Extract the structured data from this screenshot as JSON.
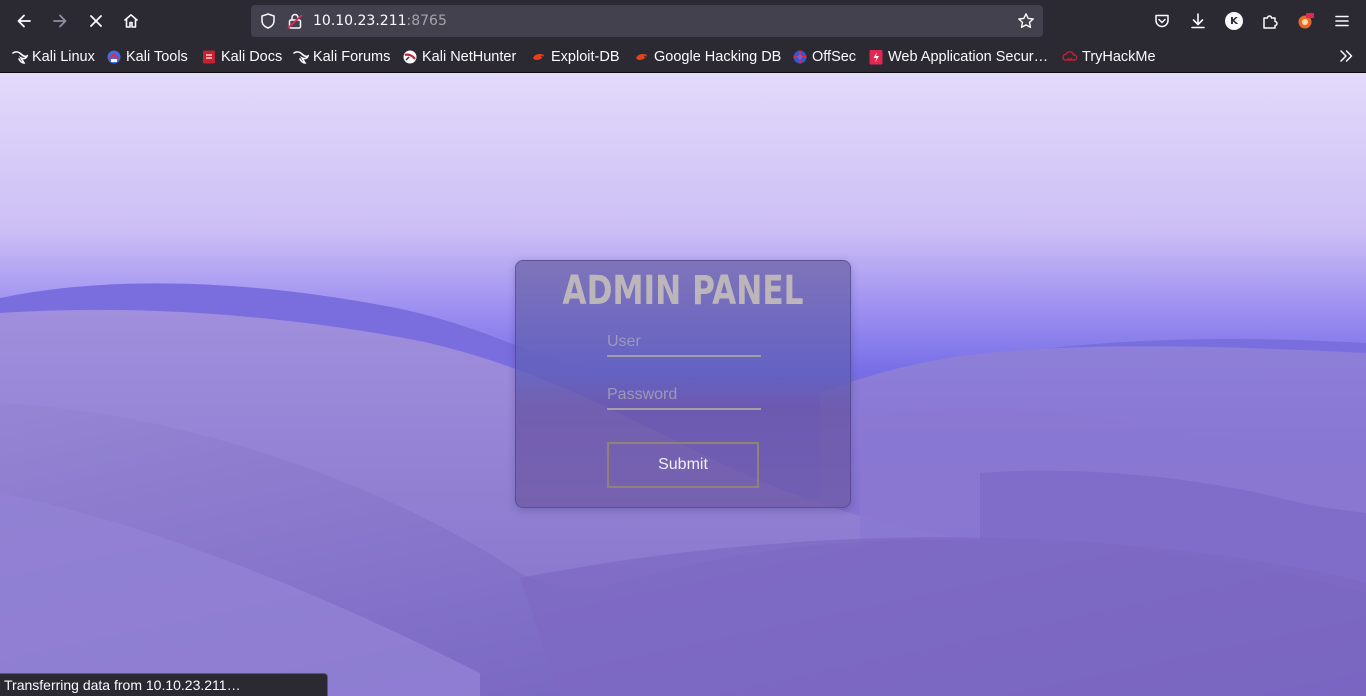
{
  "browser": {
    "url_host": "10.10.23.211",
    "url_port": ":8765",
    "status": "Transferring data from 10.10.23.211…",
    "profile_initial": "K"
  },
  "bookmarks": [
    {
      "label": "Kali Linux",
      "icon": "kali-dragon-icon"
    },
    {
      "label": "Kali Tools",
      "icon": "kali-tools-icon"
    },
    {
      "label": "Kali Docs",
      "icon": "kali-docs-icon"
    },
    {
      "label": "Kali Forums",
      "icon": "kali-dragon-icon"
    },
    {
      "label": "Kali NetHunter",
      "icon": "nethunter-icon"
    },
    {
      "label": "Exploit-DB",
      "icon": "exploit-db-icon"
    },
    {
      "label": "Google Hacking DB",
      "icon": "exploit-db-icon"
    },
    {
      "label": "OffSec",
      "icon": "offsec-icon"
    },
    {
      "label": "Web Application Secur…",
      "icon": "web-app-security-icon"
    },
    {
      "label": "TryHackMe",
      "icon": "tryhackme-icon"
    }
  ],
  "login": {
    "title": "ADMIN PANEL",
    "user_placeholder": "User",
    "password_placeholder": "Password",
    "submit_label": "Submit"
  },
  "colors": {
    "chrome_bg": "#2b2a33",
    "urlbar_bg": "#42414d",
    "panel_title": "#bcb6bb",
    "button_border": "#8f8277"
  }
}
